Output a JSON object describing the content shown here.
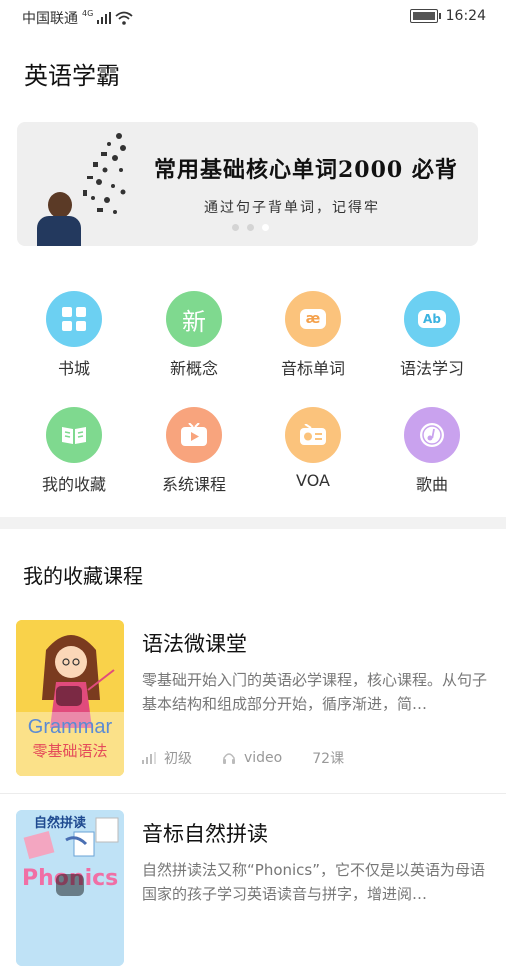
{
  "status": {
    "carrier": "中国联通",
    "network": "4G",
    "time": "16:24"
  },
  "app": {
    "title": "英语学霸"
  },
  "banner": {
    "title": "常用基础核心单词2000 必背",
    "subtitle": "通过句子背单词，记得牢",
    "slides": 3,
    "active_slide": 3
  },
  "grid": [
    {
      "label": "书城",
      "icon": "grid-icon",
      "color": "#6cd0f2"
    },
    {
      "label": "新概念",
      "icon": "new-concept-icon",
      "color": "#7fd98f"
    },
    {
      "label": "音标单词",
      "icon": "phonetic-icon",
      "color": "#fbc37c",
      "glyph": "æ"
    },
    {
      "label": "语法学习",
      "icon": "grammar-icon",
      "color": "#6cd0f2",
      "glyph": "Ab"
    },
    {
      "label": "我的收藏",
      "icon": "book-icon",
      "color": "#7fd98f"
    },
    {
      "label": "系统课程",
      "icon": "play-icon",
      "color": "#f8a47d"
    },
    {
      "label": "VOA",
      "icon": "radio-icon",
      "color": "#fbc37c"
    },
    {
      "label": "歌曲",
      "icon": "music-icon",
      "color": "#c9a2ee"
    }
  ],
  "grid_new_glyph": "新",
  "section": {
    "title": "我的收藏课程"
  },
  "courses": [
    {
      "title": "语法微课堂",
      "desc": "零基础开始入门的英语必学课程，核心课程。从句子基本结构和组成部分开始，循序渐进，简…",
      "level": "初级",
      "type": "video",
      "count": "72课",
      "cover_text_en": "Grammar",
      "cover_text_cn": "零基础语法"
    },
    {
      "title": "音标自然拼读",
      "desc": "自然拼读法又称“Phonics”，它不仅是以英语为母语国家的孩子学习英语读音与拼字，增进阅…",
      "cover_text_cn": "自然拼读",
      "cover_text_en": "Phonics"
    }
  ]
}
